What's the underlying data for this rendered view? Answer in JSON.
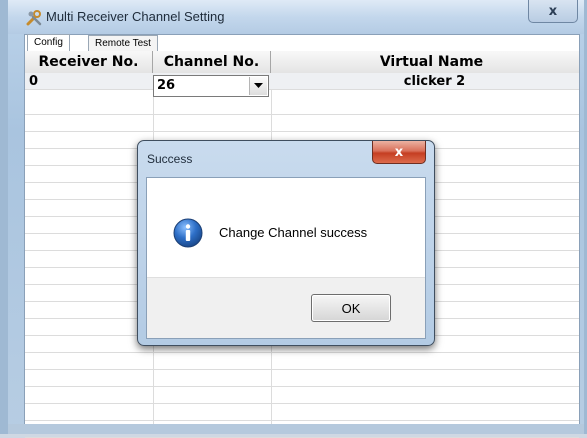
{
  "window": {
    "title": "Multi Receiver Channel Setting",
    "close_label": "x"
  },
  "tabs": [
    {
      "label": "Config",
      "active": true
    },
    {
      "label": "Remote Test",
      "active": false
    }
  ],
  "grid": {
    "columns": [
      "Receiver No.",
      "Channel No.",
      "Virtual Name"
    ],
    "rows": [
      {
        "receiver": "0",
        "channel": "26",
        "virtual_name": "clicker 2"
      }
    ]
  },
  "dialog": {
    "title": "Success",
    "close_label": "x",
    "message": "Change Channel success",
    "ok_label": "OK"
  },
  "icons": {
    "app": "tools-icon",
    "dialog": "info-icon",
    "combo": "chevron-down-icon"
  },
  "colors": {
    "title_bg": "#c3d7ec",
    "dialog_close": "#c53e22",
    "info_icon": "#2a64b8"
  }
}
